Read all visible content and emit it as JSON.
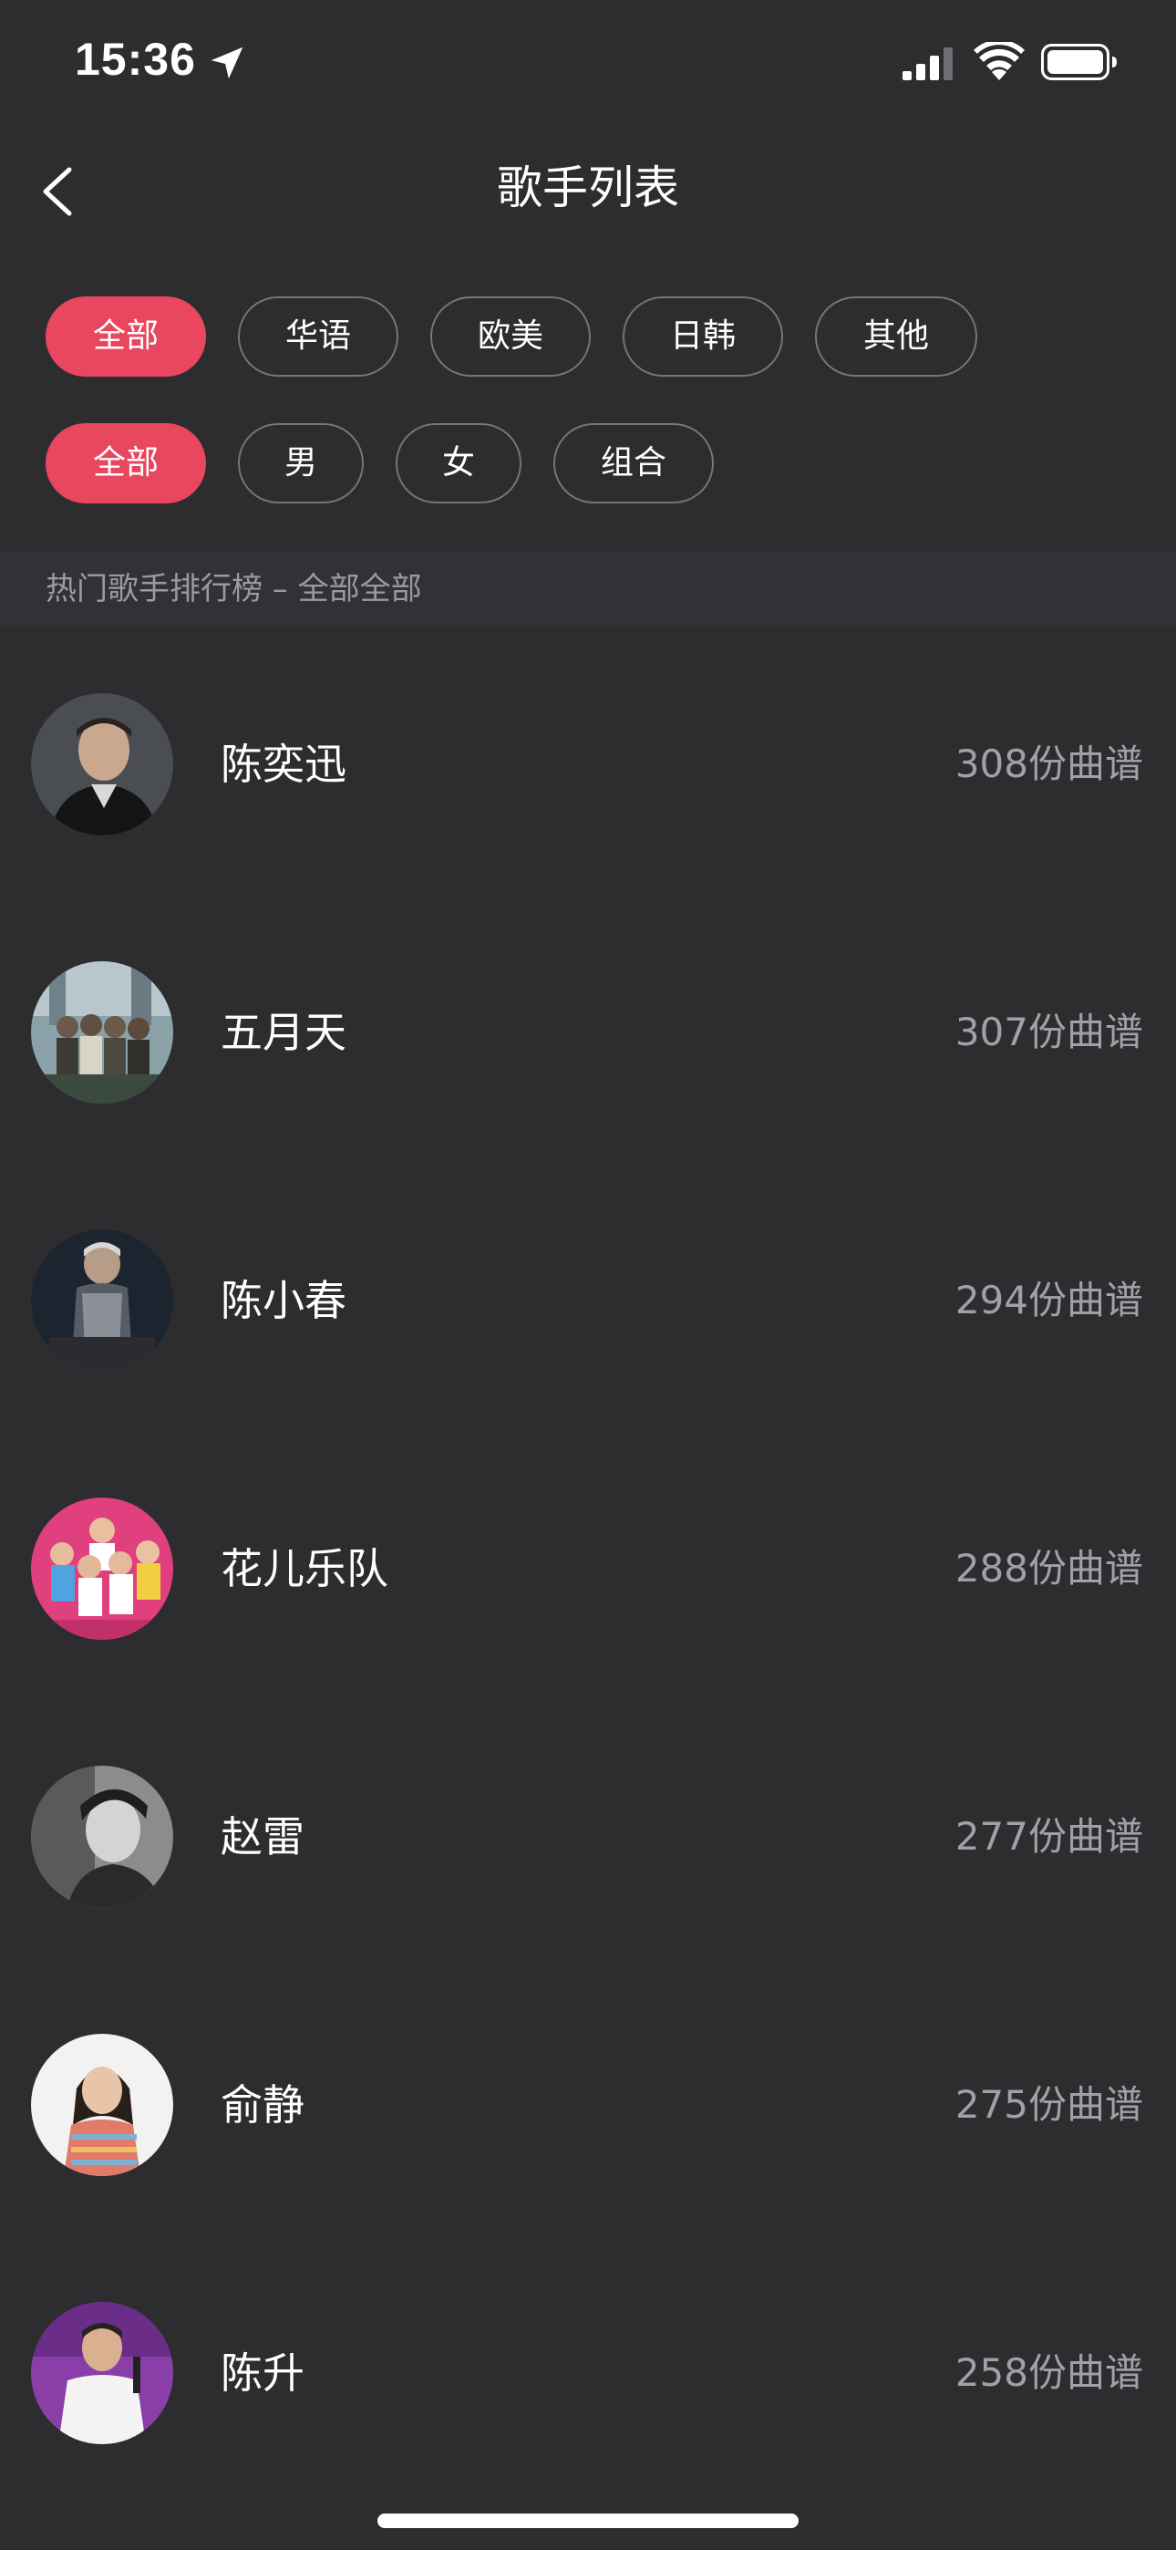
{
  "status_bar": {
    "time": "15:36"
  },
  "nav": {
    "title": "歌手列表"
  },
  "filters": {
    "region": [
      {
        "label": "全部",
        "active": true
      },
      {
        "label": "华语",
        "active": false
      },
      {
        "label": "欧美",
        "active": false
      },
      {
        "label": "日韩",
        "active": false
      },
      {
        "label": "其他",
        "active": false
      }
    ],
    "type": [
      {
        "label": "全部",
        "active": true
      },
      {
        "label": "男",
        "active": false
      },
      {
        "label": "女",
        "active": false
      },
      {
        "label": "组合",
        "active": false
      }
    ]
  },
  "section": {
    "header": "热门歌手排行榜 – 全部全部"
  },
  "singers": [
    {
      "name": "陈奕迅",
      "count": "308份曲谱"
    },
    {
      "name": "五月天",
      "count": "307份曲谱"
    },
    {
      "name": "陈小春",
      "count": "294份曲谱"
    },
    {
      "name": "花儿乐队",
      "count": "288份曲谱"
    },
    {
      "name": "赵雷",
      "count": "277份曲谱"
    },
    {
      "name": "俞静",
      "count": "275份曲谱"
    },
    {
      "name": "陈升",
      "count": "258份曲谱"
    }
  ],
  "colors": {
    "background": "#2d2d30",
    "accent": "#e8475f",
    "muted_text": "#a0a0a6"
  }
}
